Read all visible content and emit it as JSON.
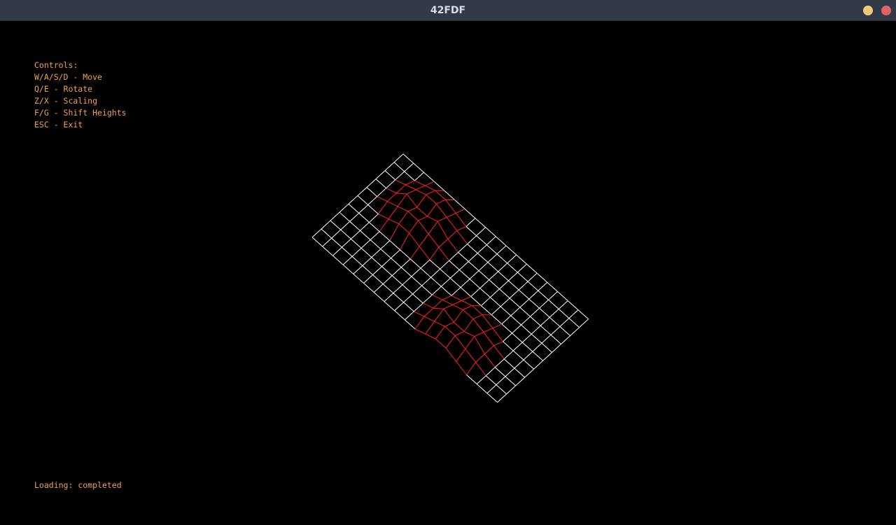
{
  "window": {
    "title": "42FDF",
    "minimize_color": "#f1c97a",
    "close_color": "#e0636c"
  },
  "hud": {
    "text_color": "#f0a055",
    "controls": [
      "Controls:",
      "W/A/S/D - Move",
      "Q/E - Rotate",
      "Z/X - Scaling",
      "F/G - Shift Heights",
      "ESC - Exit"
    ],
    "status": "Loading: completed"
  },
  "map": {
    "columns": 19,
    "rows": 11,
    "flat_color": "#ffffff",
    "raised_color": "#ff2020",
    "heights": [
      [
        0,
        0,
        0,
        0,
        0,
        0,
        0,
        0,
        0,
        0,
        0,
        0,
        0,
        0,
        0,
        0,
        0,
        0,
        0
      ],
      [
        0,
        0,
        0,
        1,
        2,
        2,
        1,
        0,
        0,
        0,
        0,
        0,
        0,
        0,
        0,
        0,
        0,
        0,
        0
      ],
      [
        0,
        0,
        1,
        2,
        3,
        3,
        2,
        1,
        0,
        0,
        0,
        0,
        0,
        0,
        0,
        0,
        0,
        0,
        0
      ],
      [
        0,
        0,
        1,
        3,
        2,
        2,
        3,
        1,
        0,
        0,
        0,
        0,
        0,
        0,
        0,
        0,
        0,
        0,
        0
      ],
      [
        0,
        0,
        1,
        2,
        3,
        3,
        2,
        1,
        0,
        0,
        0,
        0,
        0,
        0,
        0,
        0,
        0,
        0,
        0
      ],
      [
        0,
        0,
        0,
        1,
        2,
        2,
        1,
        0,
        0,
        0,
        0,
        0,
        0,
        0,
        0,
        0,
        0,
        0,
        0
      ],
      [
        0,
        0,
        0,
        0,
        0,
        0,
        0,
        0,
        0,
        0,
        0,
        1,
        2,
        2,
        1,
        0,
        0,
        0,
        0
      ],
      [
        0,
        0,
        0,
        0,
        0,
        0,
        0,
        0,
        0,
        0,
        1,
        2,
        3,
        3,
        2,
        1,
        0,
        0,
        0
      ],
      [
        0,
        0,
        0,
        0,
        0,
        0,
        0,
        0,
        0,
        0,
        1,
        3,
        2,
        2,
        3,
        1,
        0,
        0,
        0
      ],
      [
        0,
        0,
        0,
        0,
        0,
        0,
        0,
        0,
        0,
        0,
        1,
        2,
        3,
        3,
        2,
        1,
        0,
        0,
        0
      ],
      [
        0,
        0,
        0,
        0,
        0,
        0,
        0,
        0,
        0,
        0,
        0,
        1,
        2,
        2,
        1,
        0,
        0,
        0,
        0
      ]
    ]
  }
}
